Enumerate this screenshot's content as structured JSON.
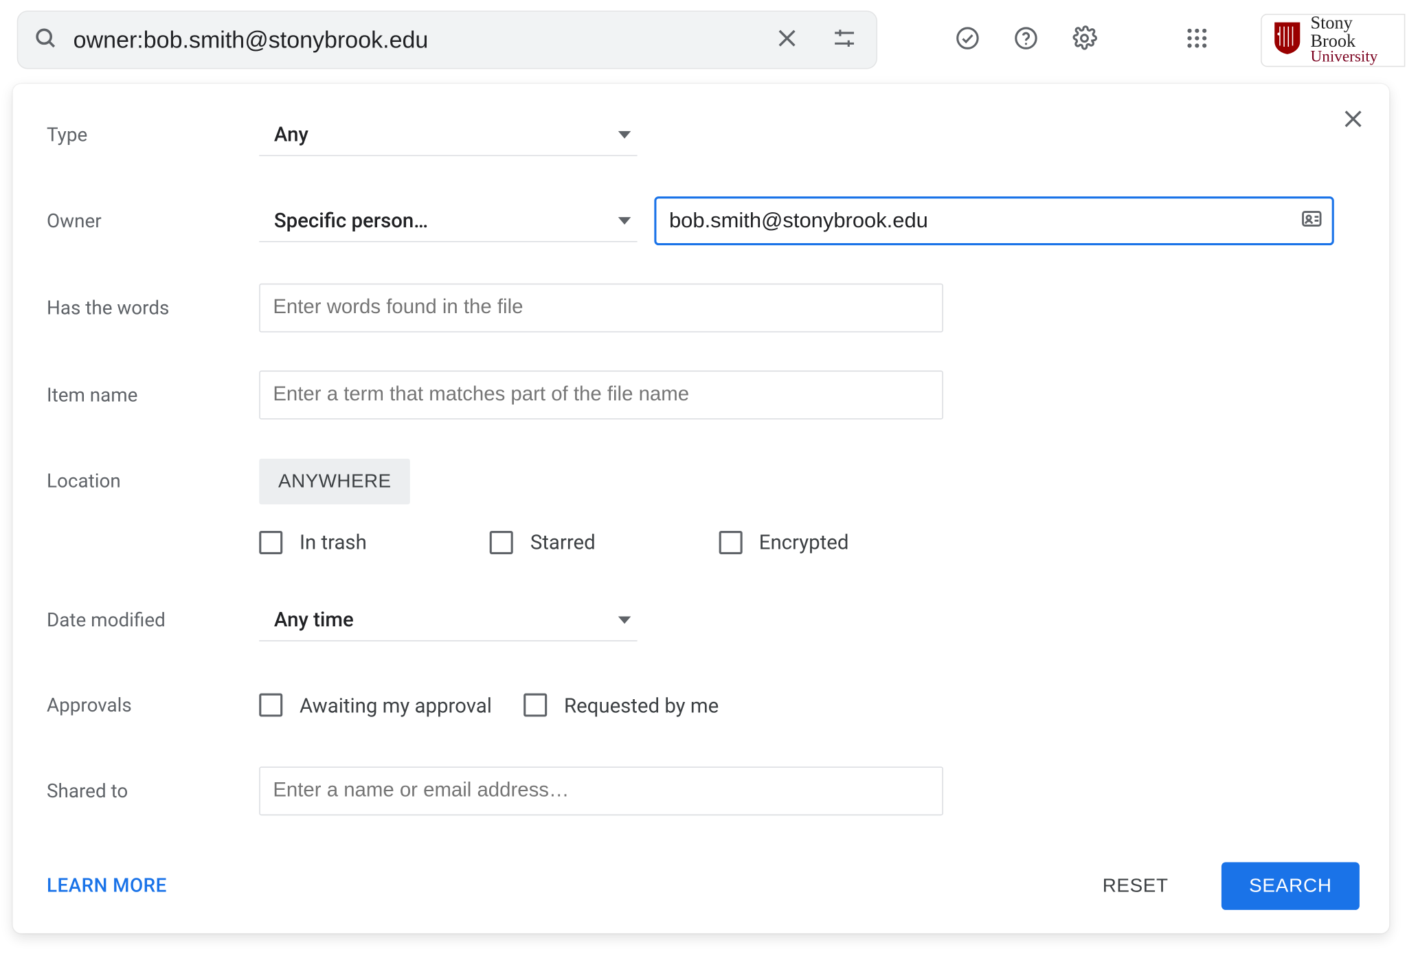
{
  "search": {
    "value": "owner:bob.smith@stonybrook.edu"
  },
  "brand": {
    "line1": "Stony Brook",
    "line2": "University"
  },
  "form": {
    "type": {
      "label": "Type",
      "value": "Any"
    },
    "owner": {
      "label": "Owner",
      "value": "Specific person…",
      "person": "bob.smith@stonybrook.edu"
    },
    "has_words": {
      "label": "Has the words",
      "placeholder": "Enter words found in the file"
    },
    "item_name": {
      "label": "Item name",
      "placeholder": "Enter a term that matches part of the file name"
    },
    "location": {
      "label": "Location",
      "chip": "ANYWHERE"
    },
    "location_checks": {
      "in_trash": "In trash",
      "starred": "Starred",
      "encrypted": "Encrypted"
    },
    "date_modified": {
      "label": "Date modified",
      "value": "Any time"
    },
    "approvals": {
      "label": "Approvals",
      "awaiting": "Awaiting my approval",
      "requested": "Requested by me"
    },
    "shared_to": {
      "label": "Shared to",
      "placeholder": "Enter a name or email address…"
    }
  },
  "footer": {
    "learn": "LEARN MORE",
    "reset": "RESET",
    "search": "SEARCH"
  }
}
